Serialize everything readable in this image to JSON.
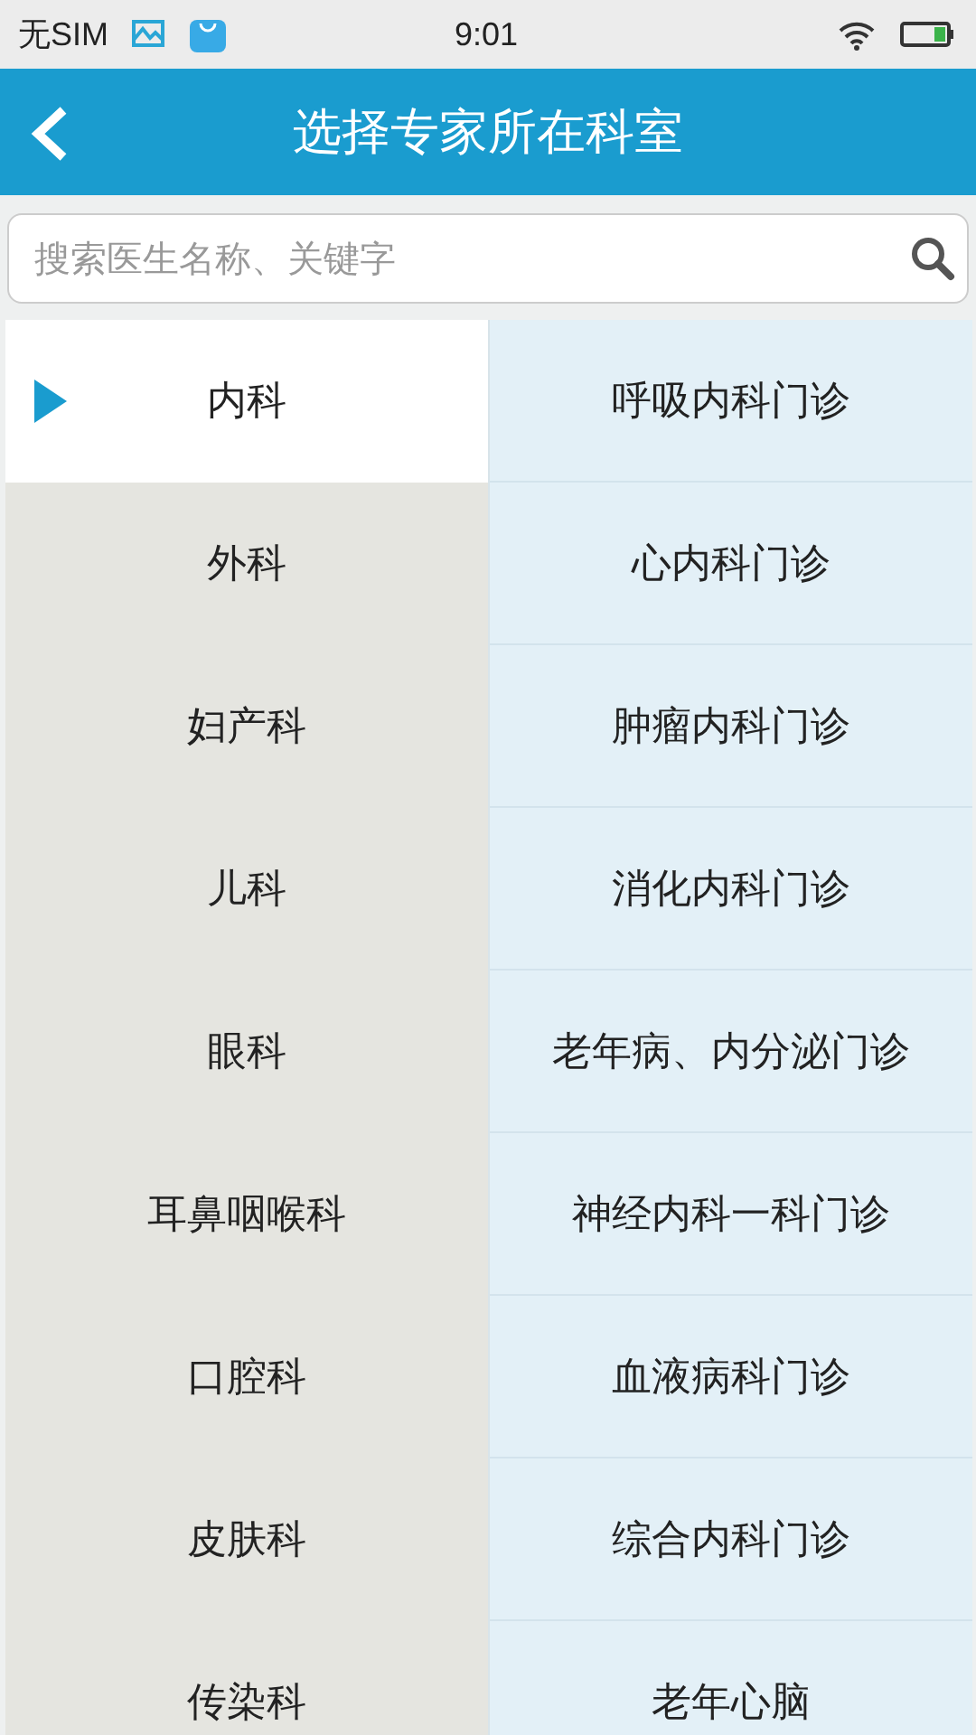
{
  "status_bar": {
    "carrier": "无SIM",
    "time": "9:01"
  },
  "header": {
    "title": "选择专家所在科室"
  },
  "search": {
    "placeholder": "搜索医生名称、关键字"
  },
  "departments": [
    {
      "label": "内科",
      "selected": true
    },
    {
      "label": "外科",
      "selected": false
    },
    {
      "label": "妇产科",
      "selected": false
    },
    {
      "label": "儿科",
      "selected": false
    },
    {
      "label": "眼科",
      "selected": false
    },
    {
      "label": "耳鼻咽喉科",
      "selected": false
    },
    {
      "label": "口腔科",
      "selected": false
    },
    {
      "label": "皮肤科",
      "selected": false
    },
    {
      "label": "传染科",
      "selected": false
    }
  ],
  "clinics": [
    "呼吸内科门诊",
    "心内科门诊",
    "肿瘤内科门诊",
    "消化内科门诊",
    "老年病、内分泌门诊",
    "神经内科一科门诊",
    "血液病科门诊",
    "综合内科门诊",
    "老年心脑"
  ]
}
